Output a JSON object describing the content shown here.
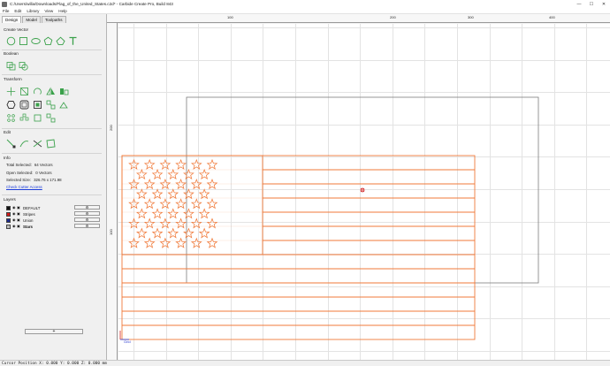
{
  "window": {
    "title": "C:/Users/willa/Downloads/Flag_of_the_United_States.c2d* - Carbide Create Pro, Build 843",
    "minimize": "—",
    "maximize": "☐",
    "close": "✕"
  },
  "menu": [
    "File",
    "Edit",
    "Library",
    "View",
    "Help"
  ],
  "panel": {
    "tabs": [
      "Design",
      "Model",
      "Toolpaths"
    ],
    "active_tab": "Design",
    "sections": {
      "create_vector": "Create Vector",
      "boolean": "Boolean",
      "transform": "Transform",
      "edit": "Edit",
      "info": "Info",
      "layers": "Layers"
    },
    "info": {
      "total_selected_label": "Total Selected:",
      "total_selected_value": "64 Vectors",
      "open_selected_label": "Open Selected:",
      "open_selected_value": "0 Vectors",
      "selected_size_label": "Selected Size:",
      "selected_size_value": "326.76 x 171.98",
      "check_cutter_access": "Check Cutter Access"
    },
    "layers": [
      {
        "name": "DEFAULT",
        "color": "#111111",
        "bold": false
      },
      {
        "name": "Stripes",
        "color": "#d01818",
        "bold": false
      },
      {
        "name": "Union",
        "color": "#1c2a8a",
        "bold": false
      },
      {
        "name": "Stars",
        "color": "#bcbcbc",
        "bold": true
      }
    ],
    "layer_settings_icon": "gear-icon",
    "add_layer": "+"
  },
  "rulers": {
    "top": [
      "100",
      "200",
      "300",
      "400"
    ],
    "left": [
      "200",
      "100"
    ]
  },
  "canvas": {
    "grid_label": "Grid",
    "stripe_color": "#f07a3a",
    "star_color": "#f07a3a",
    "stock_color": "#7d7d7d",
    "center_marker_color": "#d02020"
  },
  "status": {
    "cursor_position": "Cursor Position X: 0.000 Y: 0.000 Z: 0.000 mm"
  }
}
